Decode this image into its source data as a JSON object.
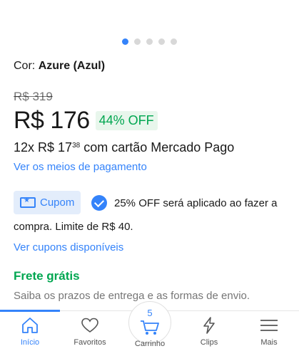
{
  "gallery": {
    "dot_count": 5,
    "active_index": 0
  },
  "product": {
    "color_label": "Cor:",
    "color_value": "Azure (Azul)",
    "old_price": "R$ 319",
    "price": "R$ 176",
    "discount": "44% OFF",
    "installments_prefix": "12x R$ 17",
    "installments_cents": "38",
    "installments_suffix": "com cartão Mercado Pago",
    "payment_link": "Ver os meios de pagamento"
  },
  "coupon": {
    "badge_label": "Cupom",
    "text_line1": "25% OFF será aplicado ao fazer a",
    "text_line2": "compra. Limite de R$ 40.",
    "link": "Ver cupons disponíveis"
  },
  "shipping": {
    "title": "Frete grátis",
    "note": "Saiba os prazos de entrega e as formas de envio."
  },
  "navbar": {
    "items": [
      {
        "label": "Início",
        "icon": "home-icon",
        "active": true
      },
      {
        "label": "Favoritos",
        "icon": "heart-icon",
        "active": false
      },
      {
        "label": "Carrinho",
        "icon": "cart-icon",
        "active": false,
        "count": "5"
      },
      {
        "label": "Clips",
        "icon": "lightning-icon",
        "active": false
      },
      {
        "label": "Mais",
        "icon": "menu-icon",
        "active": false
      }
    ]
  },
  "colors": {
    "accent": "#3483fa",
    "success": "#00a650"
  }
}
